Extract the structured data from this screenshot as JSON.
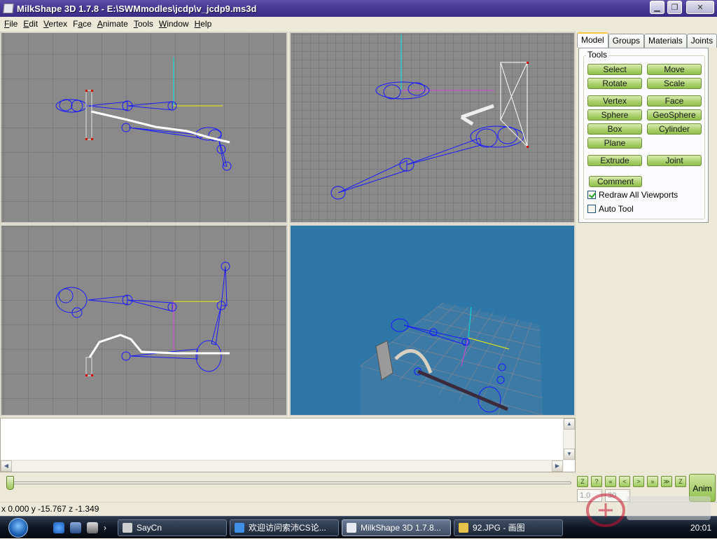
{
  "window": {
    "title": "MilkShape 3D 1.7.8 - E:\\SWMmodles\\jcdp\\v_jcdp9.ms3d",
    "minimize_glyph": "▁",
    "maximize_glyph": "❐",
    "close_glyph": "✕"
  },
  "menu": [
    {
      "pre": "",
      "u": "F",
      "post": "ile"
    },
    {
      "pre": "",
      "u": "E",
      "post": "dit"
    },
    {
      "pre": "",
      "u": "V",
      "post": "ertex"
    },
    {
      "pre": "F",
      "u": "a",
      "post": "ce"
    },
    {
      "pre": "",
      "u": "A",
      "post": "nimate"
    },
    {
      "pre": "",
      "u": "T",
      "post": "ools"
    },
    {
      "pre": "",
      "u": "W",
      "post": "indow"
    },
    {
      "pre": "",
      "u": "H",
      "post": "elp"
    }
  ],
  "panel": {
    "tabs": [
      "Model",
      "Groups",
      "Materials",
      "Joints"
    ],
    "active_tab": "Model",
    "group_label": "Tools",
    "buttons": {
      "select": "Select",
      "move": "Move",
      "rotate": "Rotate",
      "scale": "Scale",
      "vertex": "Vertex",
      "face": "Face",
      "sphere": "Sphere",
      "geosphere": "GeoSphere",
      "box": "Box",
      "cylinder": "Cylinder",
      "plane": "Plane",
      "extrude": "Extrude",
      "joint": "Joint",
      "comment": "Comment"
    },
    "checkboxes": [
      {
        "label": "Redraw All Viewports",
        "checked": true
      },
      {
        "label": "Auto Tool",
        "checked": false
      }
    ]
  },
  "animation": {
    "buttons": [
      "Z",
      "?",
      "«",
      "<",
      ">",
      "»",
      "≫",
      "Z"
    ],
    "frame_start": "1.0",
    "frame_end": "30",
    "anim_label": "Anim",
    "slider_position": 0.0
  },
  "status": {
    "coords": "x 0.000 y -15.767 z -1.349"
  },
  "taskbar": {
    "tasks": [
      {
        "label": "SayCn",
        "active": false
      },
      {
        "label": "欢迎访问索沛CS论...",
        "active": false
      },
      {
        "label": "MilkShape 3D 1.7.8...",
        "active": true
      },
      {
        "label": "92.JPG - 画图",
        "active": false
      }
    ],
    "clock": "20:01"
  },
  "colors": {
    "viewport_gray": "#8a8a8a",
    "viewport_3d": "#2e76a6",
    "wire": "#1a1aff",
    "button_green": "#a9cf6a",
    "axis_yellow": "#f2f200",
    "axis_cyan": "#00e5e5",
    "axis_magenta": "#e040e0"
  }
}
